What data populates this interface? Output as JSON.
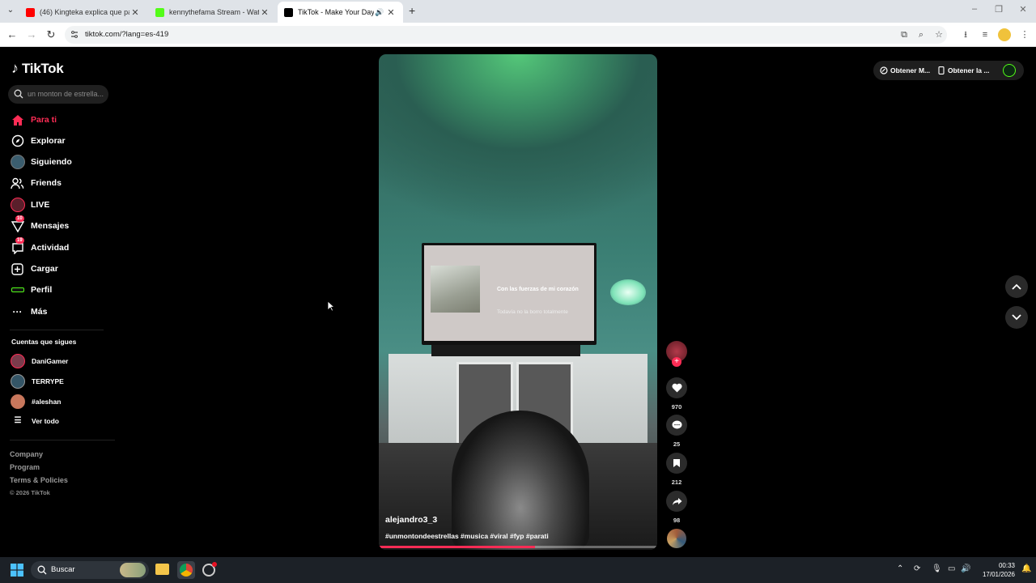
{
  "browser": {
    "tabs": [
      {
        "title": "(46) Kingteka explica que pasó",
        "favicon_color": "#ff0000",
        "active": false
      },
      {
        "title": "kennythefama Stream - Watch",
        "favicon_color": "#53fc18",
        "active": false
      },
      {
        "title": "TikTok - Make Your Day",
        "favicon_color": "#000000",
        "active": true
      }
    ],
    "url": "tiktok.com/?lang=es-419"
  },
  "sidebar": {
    "logo_text": "TikTok",
    "search_placeholder": "un monton de estrella...",
    "nav": [
      {
        "label": "Para ti",
        "icon": "home-icon",
        "active": true
      },
      {
        "label": "Explorar",
        "icon": "compass-icon"
      },
      {
        "label": "Siguiendo",
        "icon": "following-avatar-icon"
      },
      {
        "label": "Friends",
        "icon": "friends-icon"
      },
      {
        "label": "LIVE",
        "icon": "live-icon"
      },
      {
        "label": "Mensajes",
        "icon": "messages-icon",
        "badge": "10"
      },
      {
        "label": "Actividad",
        "icon": "activity-icon",
        "badge": "19"
      },
      {
        "label": "Cargar",
        "icon": "upload-icon"
      },
      {
        "label": "Perfil",
        "icon": "profile-icon"
      },
      {
        "label": "Más",
        "icon": "more-icon"
      }
    ],
    "following_title": "Cuentas que sigues",
    "following": [
      {
        "name": "DaniGamer"
      },
      {
        "name": "TERRYPE"
      },
      {
        "name": "#aleshan"
      },
      {
        "name": "Ver todo"
      }
    ],
    "footer": [
      "Company",
      "Program",
      "Terms & Policies"
    ],
    "copyright": "© 2026 TikTok"
  },
  "video": {
    "tv_lyric_main": "Con las fuerzas de mi corazón",
    "tv_lyric_next": "Todavía no la borro totalmente",
    "username": "alejandro3_3",
    "hashtags": "#unmontondeestrellas #musica #viral #fyp #parati",
    "progress": 0.56
  },
  "actions": {
    "likes": "970",
    "comments": "25",
    "saves": "212",
    "shares": "98"
  },
  "topbar": {
    "get_app_1": "Obtener M...",
    "get_app_2": "Obtener la ..."
  },
  "taskbar": {
    "search_placeholder": "Buscar",
    "time": "00:33",
    "date": "17/01/2026"
  },
  "colors": {
    "accent": "#fe2c55",
    "background": "#000000"
  }
}
